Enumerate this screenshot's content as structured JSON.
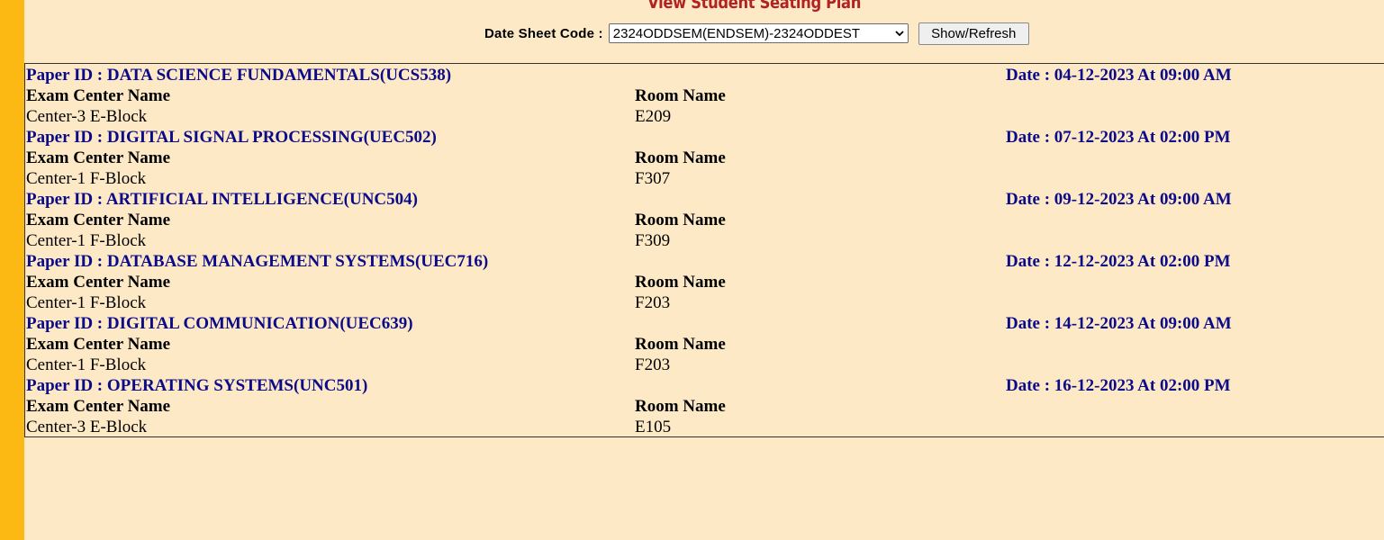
{
  "page": {
    "title": "View Student Seating Plan"
  },
  "filter": {
    "label": "Date Sheet Code :",
    "selected": "2324ODDSEM(ENDSEM)-2324ODDEST",
    "button_label": "Show/Refresh"
  },
  "headers": {
    "center": "Exam Center Name",
    "room": "Room Name"
  },
  "papers": [
    {
      "paper": "Paper ID : DATA SCIENCE FUNDAMENTALS(UCS538)",
      "date": "Date : 04-12-2023 At 09:00 AM",
      "center": "Center-3 E-Block",
      "room": "E209"
    },
    {
      "paper": "Paper ID : DIGITAL SIGNAL PROCESSING(UEC502)",
      "date": "Date : 07-12-2023 At 02:00 PM",
      "center": "Center-1 F-Block",
      "room": "F307"
    },
    {
      "paper": "Paper ID : ARTIFICIAL INTELLIGENCE(UNC504)",
      "date": "Date : 09-12-2023 At 09:00 AM",
      "center": "Center-1 F-Block",
      "room": "F309"
    },
    {
      "paper": "Paper ID : DATABASE MANAGEMENT SYSTEMS(UEC716)",
      "date": "Date : 12-12-2023 At 02:00 PM",
      "center": "Center-1 F-Block",
      "room": "F203"
    },
    {
      "paper": "Paper ID : DIGITAL COMMUNICATION(UEC639)",
      "date": "Date : 14-12-2023 At 09:00 AM",
      "center": "Center-1 F-Block",
      "room": "F203"
    },
    {
      "paper": "Paper ID : OPERATING SYSTEMS(UNC501)",
      "date": "Date : 16-12-2023 At 02:00 PM",
      "center": "Center-3 E-Block",
      "room": "E105"
    }
  ],
  "colors": {
    "background": "#fde9c6",
    "side_bar": "#fdb913",
    "title": "#b22222",
    "paper_text": "#0b0b8a"
  }
}
